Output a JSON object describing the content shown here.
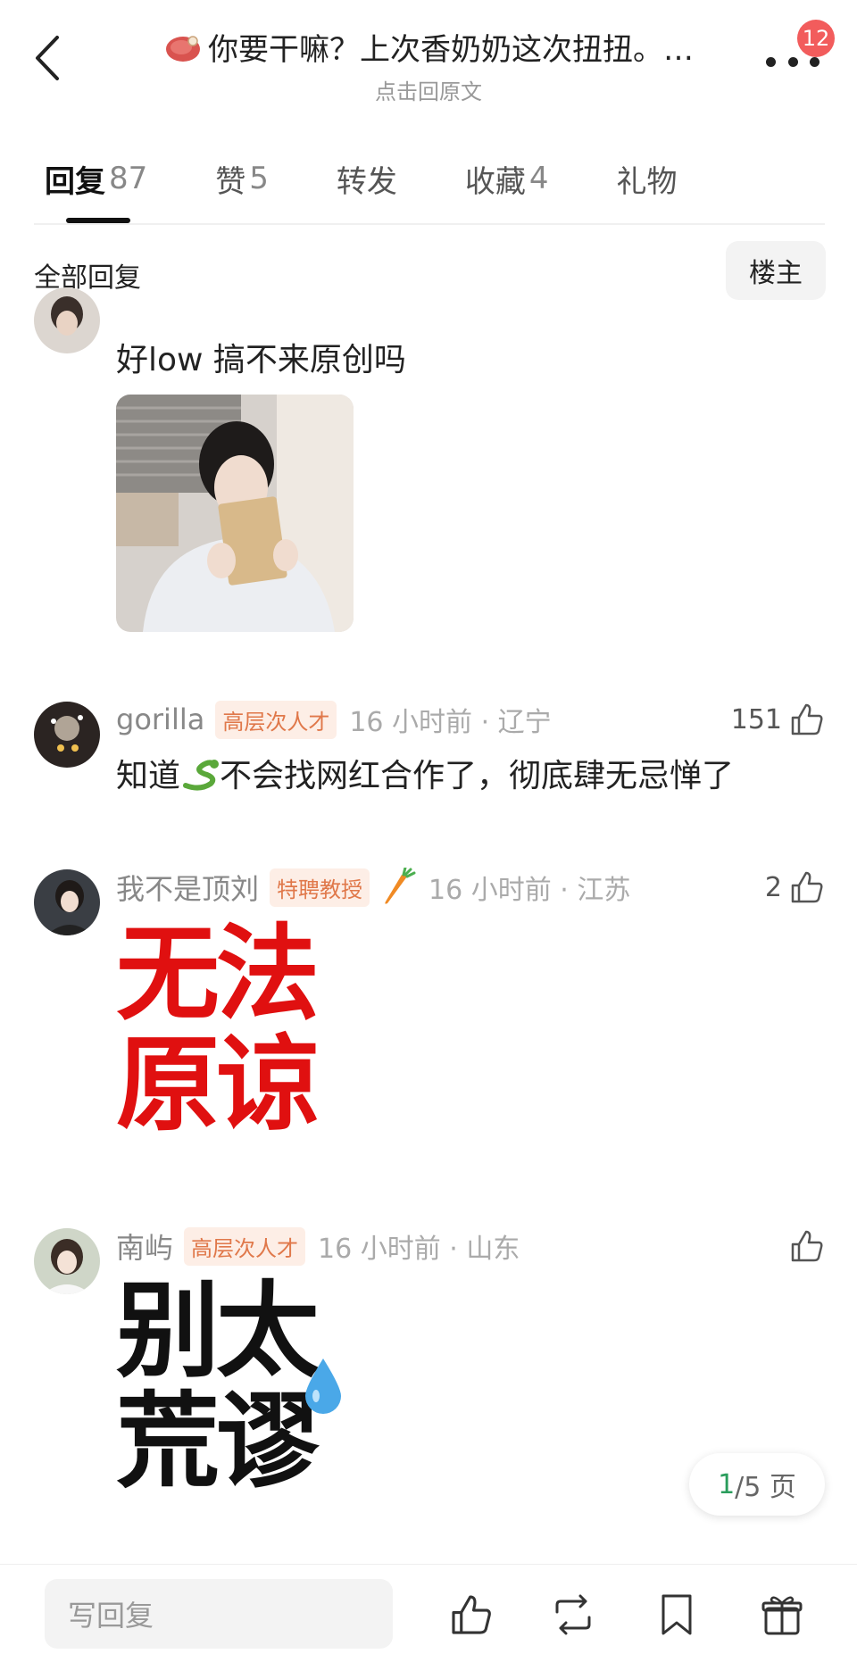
{
  "header": {
    "title": "你要干嘛？上次香奶奶这次扭扭。…",
    "subtitle": "点击回原文",
    "notification_count": "12"
  },
  "tabs": [
    {
      "label": "回复",
      "count": "87",
      "active": true
    },
    {
      "label": "赞",
      "count": "5",
      "active": false
    },
    {
      "label": "转发",
      "count": "",
      "active": false
    },
    {
      "label": "收藏",
      "count": "4",
      "active": false
    },
    {
      "label": "礼物",
      "count": "",
      "active": false
    }
  ],
  "filter": {
    "label": "全部回复",
    "owner_button": "楼主"
  },
  "comments": [
    {
      "text": "好low 搞不来原创吗"
    },
    {
      "username": "gorilla",
      "tag": "高层次人才",
      "time_loc": "16 小时前 · 辽宁",
      "likes": "151",
      "text_before": "知道",
      "text_after": "不会找网红合作了，彻底肆无忌惮了"
    },
    {
      "username": "我不是顶刘",
      "tag": "特聘教授",
      "time_loc": "16 小时前 · 江苏",
      "likes": "2",
      "meme_line1": "无法",
      "meme_line2": "原谅"
    },
    {
      "username": "南屿",
      "tag": "高层次人才",
      "time_loc": "16 小时前 · 山东",
      "likes": "",
      "meme_line1": "别太",
      "meme_line2": "荒谬"
    }
  ],
  "pagination": {
    "current": "1",
    "total": "/5 页"
  },
  "bottom_bar": {
    "reply_placeholder": "写回复"
  },
  "colors": {
    "accent_red": "#e01010",
    "tag_text": "#e0784a",
    "tag_bg": "#fdeee6",
    "badge": "#f25c5c",
    "page_current": "#2a9d5c"
  },
  "icons": [
    "back-arrow-icon",
    "steak-emoji-icon",
    "more-icon",
    "thumbs-up-icon",
    "snake-emoji-icon",
    "carrot-emoji-icon",
    "sweat-drop-emoji-icon",
    "repost-icon",
    "bookmark-icon",
    "gift-icon"
  ]
}
